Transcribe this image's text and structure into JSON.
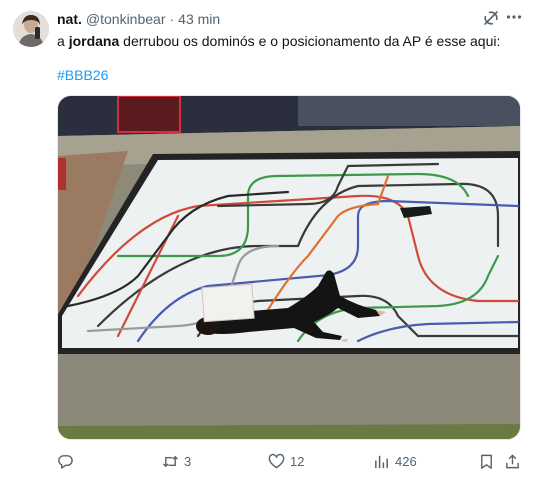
{
  "user": {
    "name": "nat.",
    "handle": "@tonkinbear",
    "separator": "·",
    "time": "43 min"
  },
  "tweet": {
    "text_prefix": "a ",
    "text_bold": "jordana",
    "text_rest": " derrubou os dominós e o posicionamento da AP é esse aqui:",
    "hashtag": "#BBB26"
  },
  "actions": {
    "reply_count": "",
    "retweet_count": "3",
    "like_count": "12",
    "view_count": "426"
  },
  "icons": {
    "grok": "grok-icon",
    "more": "more-icon",
    "reply": "reply-icon",
    "retweet": "retweet-icon",
    "like": "heart-icon",
    "views": "views-chart-icon",
    "bookmark": "bookmark-icon",
    "share": "share-icon"
  },
  "colors": {
    "text": "#0f1419",
    "muted": "#536471",
    "link": "#1d9bf0"
  }
}
